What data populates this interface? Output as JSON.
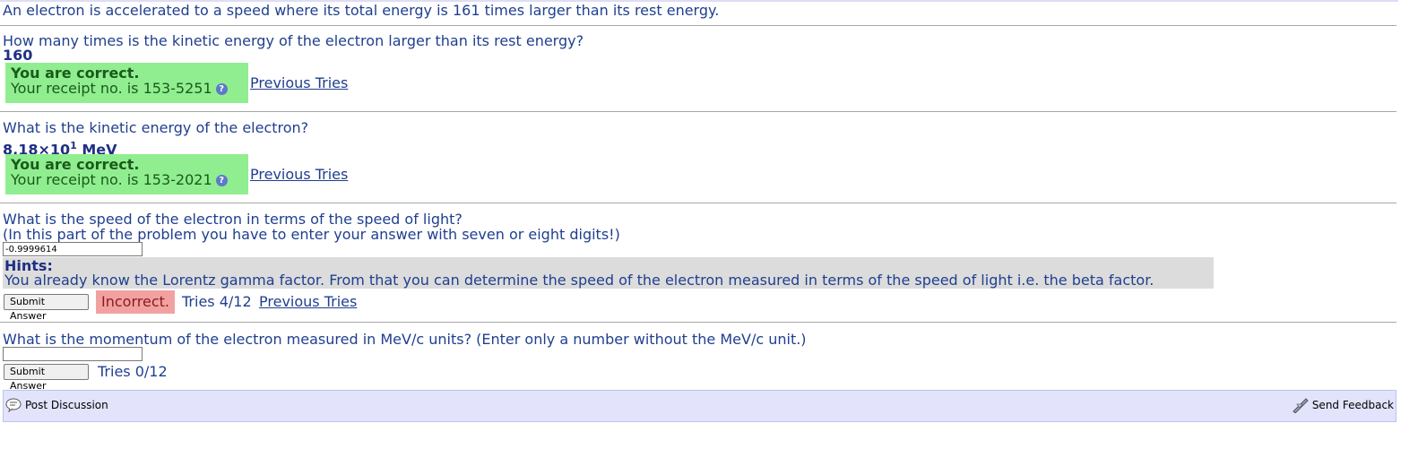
{
  "problem_statement": "An electron is accelerated to a speed where its total energy is 161 times larger than its rest energy.",
  "parts": [
    {
      "question": "How many times is the kinetic energy of the electron larger than its rest energy?",
      "answer": "160",
      "status_title": "You are correct.",
      "receipt": "Your receipt no. is 153-5251",
      "previous_tries": "Previous Tries"
    },
    {
      "question": "What is the kinetic energy of the electron?",
      "answer_mantissa": "8.18×10",
      "answer_exponent": "1",
      "answer_unit": " MeV",
      "status_title": "You are correct.",
      "receipt": "Your receipt no. is 153-2021",
      "previous_tries": "Previous Tries"
    },
    {
      "question": "What is the speed of the electron in terms of the speed of light?",
      "note": "(In this part of the problem you have to enter your answer with seven or eight digits!)",
      "input_value": "-0.9999614",
      "hints_title": "Hints:",
      "hints_text": "You already know the Lorentz gamma factor. From that you can determine the speed of the electron measured in terms of the speed of light i.e. the beta factor.",
      "submit_label": "Submit Answer",
      "status": "Incorrect.",
      "tries": "Tries 4/12",
      "previous_tries": "Previous Tries"
    },
    {
      "question": "What is the momentum of the electron measured in MeV/c units? (Enter only a number without the MeV/c unit.)",
      "input_value": "",
      "submit_label": "Submit Answer",
      "tries": "Tries 0/12"
    }
  ],
  "footer": {
    "post_discussion": "Post Discussion",
    "send_feedback": "Send Feedback"
  },
  "colors": {
    "correct_bg": "#90ee90",
    "incorrect_bg": "#f2a1a1",
    "text_blue": "#1f3f8f",
    "hints_bg": "#dcdcdc",
    "footer_bg": "#e3e3fb"
  }
}
